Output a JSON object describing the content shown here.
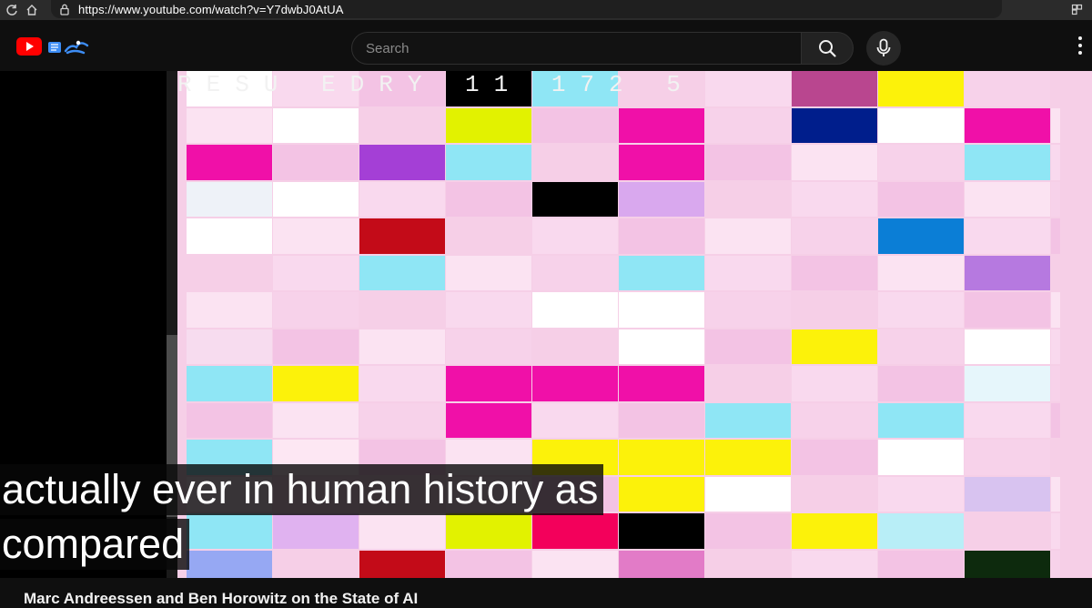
{
  "browser": {
    "url": "https://www.youtube.com/watch?v=Y7dwbJ0AtUA",
    "icons": [
      "reload-icon",
      "home-icon",
      "site-info-icon",
      "extensions-icon",
      "favorite-star-icon"
    ]
  },
  "header": {
    "logo": "youtube-logo-icon",
    "search_placeholder": "Search",
    "search_button": "search-icon",
    "mic_button": "microphone-icon",
    "more": "more-vertical-icon"
  },
  "video": {
    "overlay_text": "RESU    EDRY  11 172 5",
    "captions": [
      "actually ever in human history as",
      "compared"
    ],
    "colors": {
      "pink_bg": "#f6cfe7",
      "magenta": "#f010a8",
      "yellow": "#fcf20a",
      "cyan": "#8fe6f5",
      "navy": "#001e8c",
      "black": "#000000",
      "red": "#c30b18",
      "purple": "#a43fd6",
      "blue": "#0b7ed6"
    }
  },
  "title": "Marc Andreessen and Ben Horowitz on the State of AI"
}
